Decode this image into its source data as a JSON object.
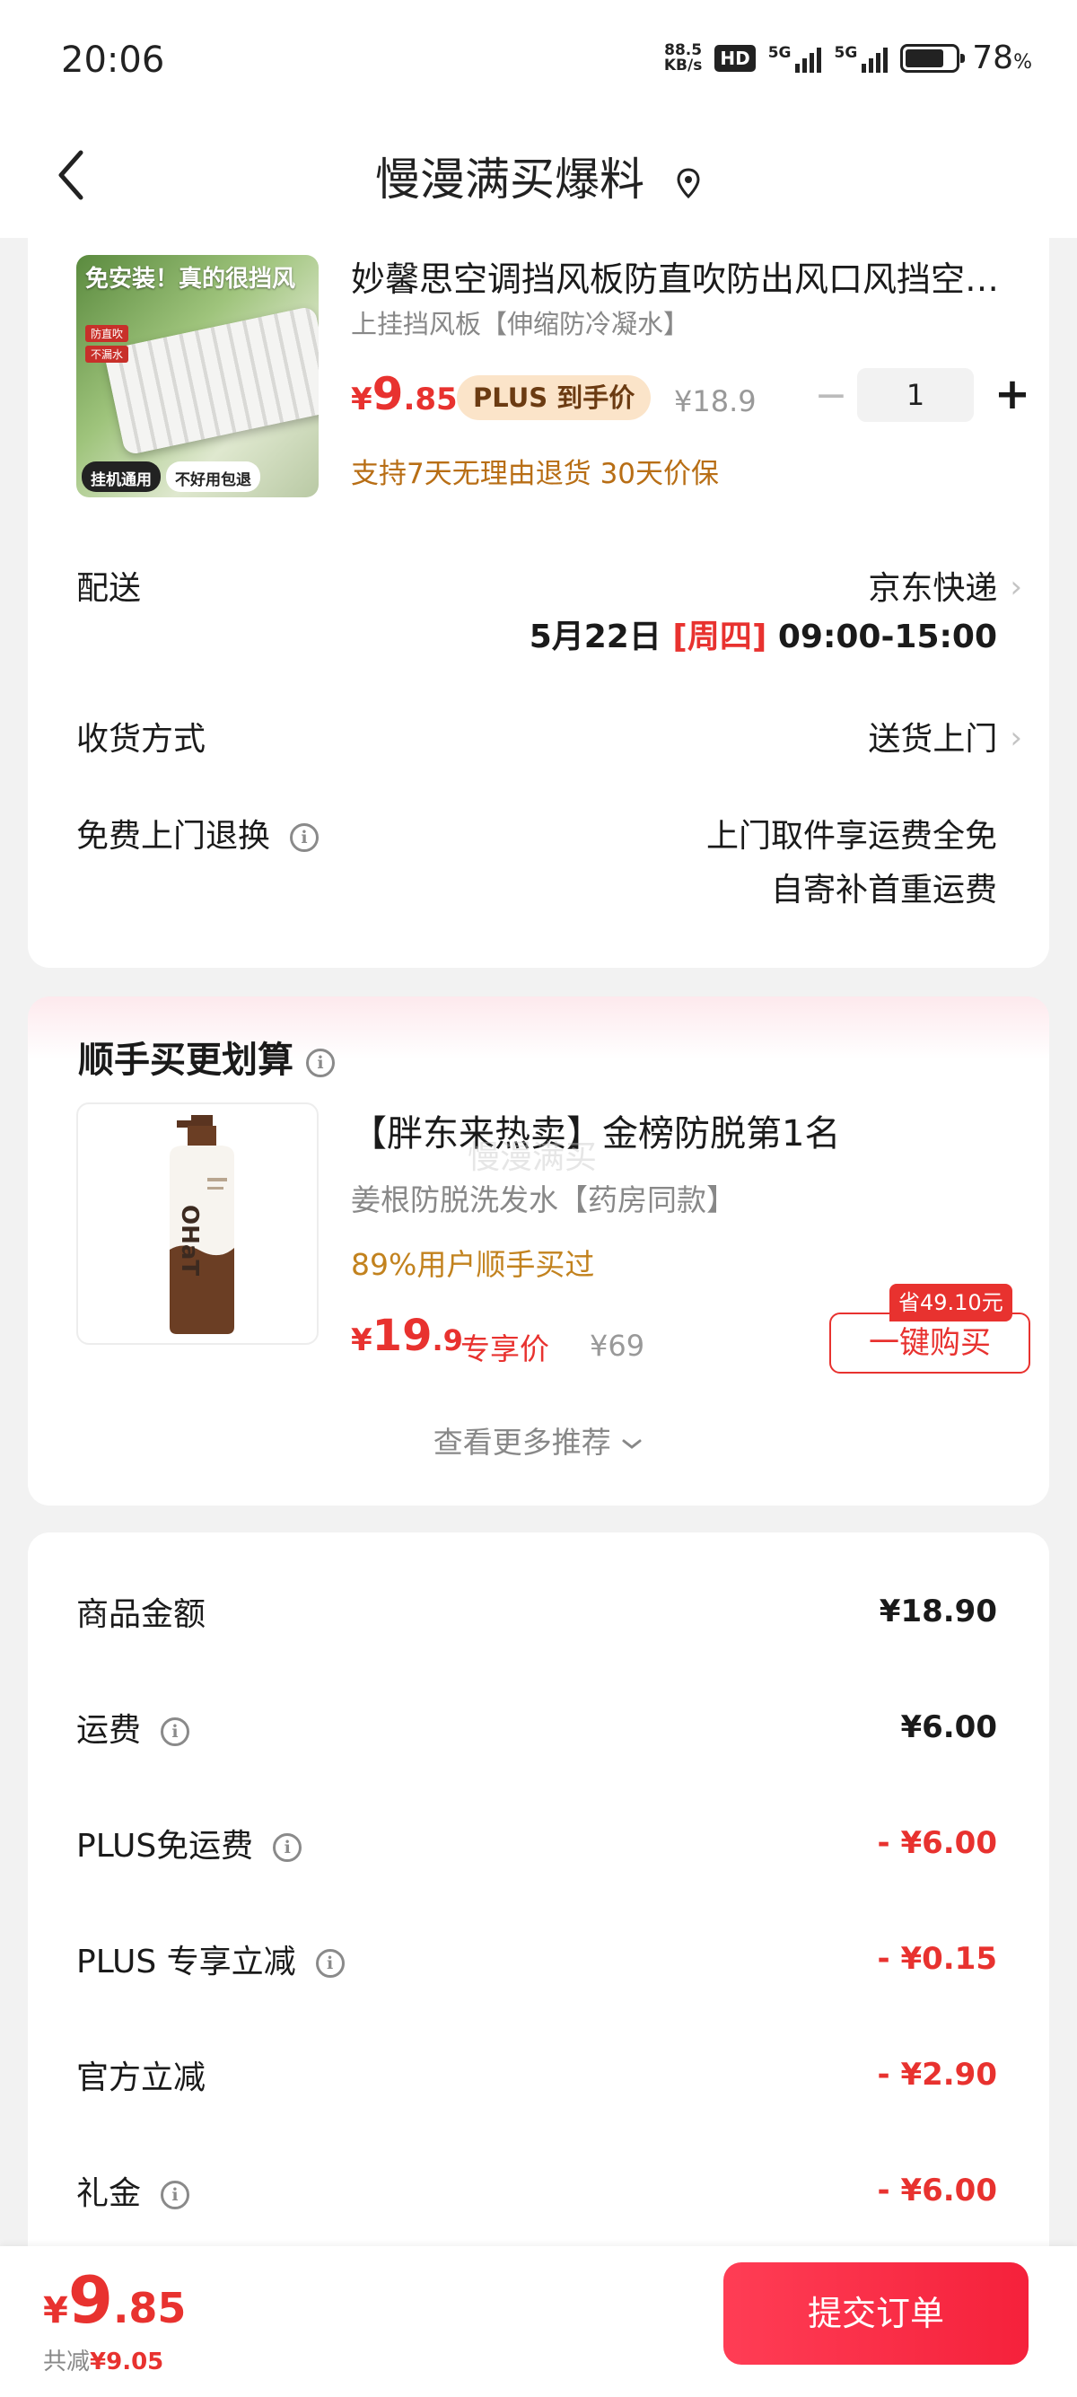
{
  "status_bar": {
    "time": "20:06",
    "net_speed_value": "88.5",
    "net_speed_unit": "KB/s",
    "hd_label": "HD",
    "signal1_label": "5G",
    "signal2_label": "5G",
    "battery_percent": "78",
    "battery_level": 0.78
  },
  "header": {
    "title": "慢漫满买爆料"
  },
  "product": {
    "title": "妙馨思空调挡风板防直吹防出风口风挡空调挡风板",
    "subtitle": "上挂挡风板【伸缩防冷凝水】",
    "image_headline": "免安装！真的很挡风",
    "image_tags": [
      "防直吹",
      "不漏水"
    ],
    "image_badge_left": "挂机通用",
    "image_badge_right": "不好用包退",
    "price_symbol": "¥",
    "price_int": "9",
    "price_dec": ".85",
    "plus_tag": "PLUS 到手价",
    "original_price": "¥18.9",
    "quantity": "1",
    "quantity_minus": "−",
    "quantity_plus": "+",
    "service": "支持7天无理由退货  30天价保"
  },
  "delivery": {
    "label": "配送",
    "carrier": "京东快递",
    "date": "5月22日",
    "weekday": "[周四]",
    "time_range": "09:00-15:00"
  },
  "receive": {
    "label": "收货方式",
    "value": "送货上门"
  },
  "free_return": {
    "label": "免费上门退换",
    "line1": "上门取件享运费全免",
    "line2": "自寄补首重运费"
  },
  "recommend": {
    "title": "顺手买更划算",
    "name": "【胖东来热卖】金榜防脱第1名",
    "watermark": "慢漫满买",
    "subtitle": "姜根防脱洗发水【药房同款】",
    "stat": "89%用户顺手买过",
    "price_symbol": "¥",
    "price_int": "19",
    "price_dec": ".9",
    "price_label": "专享价",
    "original_price": "¥69",
    "save_badge": "省49.10元",
    "buy_button": "一键购买",
    "more_link": "查看更多推荐"
  },
  "summary": {
    "rows": [
      {
        "label": "商品金额",
        "value": "¥18.90",
        "info": false,
        "negative": false
      },
      {
        "label": "运费",
        "value": "¥6.00",
        "info": true,
        "negative": false
      },
      {
        "label": "PLUS免运费",
        "value": "- ¥6.00",
        "info": true,
        "negative": true
      },
      {
        "label": "PLUS 专享立减",
        "value": "- ¥0.15",
        "info": true,
        "negative": true
      },
      {
        "label": "官方立减",
        "value": "- ¥2.90",
        "info": false,
        "negative": true
      },
      {
        "label": "礼金",
        "value": "- ¥6.00",
        "info": true,
        "negative": true
      }
    ]
  },
  "footer": {
    "price_symbol": "¥",
    "price_int": "9",
    "price_dec": ".85",
    "save_label": "共减",
    "save_value": "¥9.05",
    "submit": "提交订单"
  },
  "colors": {
    "accent_red": "#e8322f",
    "service_orange": "#b86e15",
    "plus_tag_bg": "#fbe4c9"
  }
}
